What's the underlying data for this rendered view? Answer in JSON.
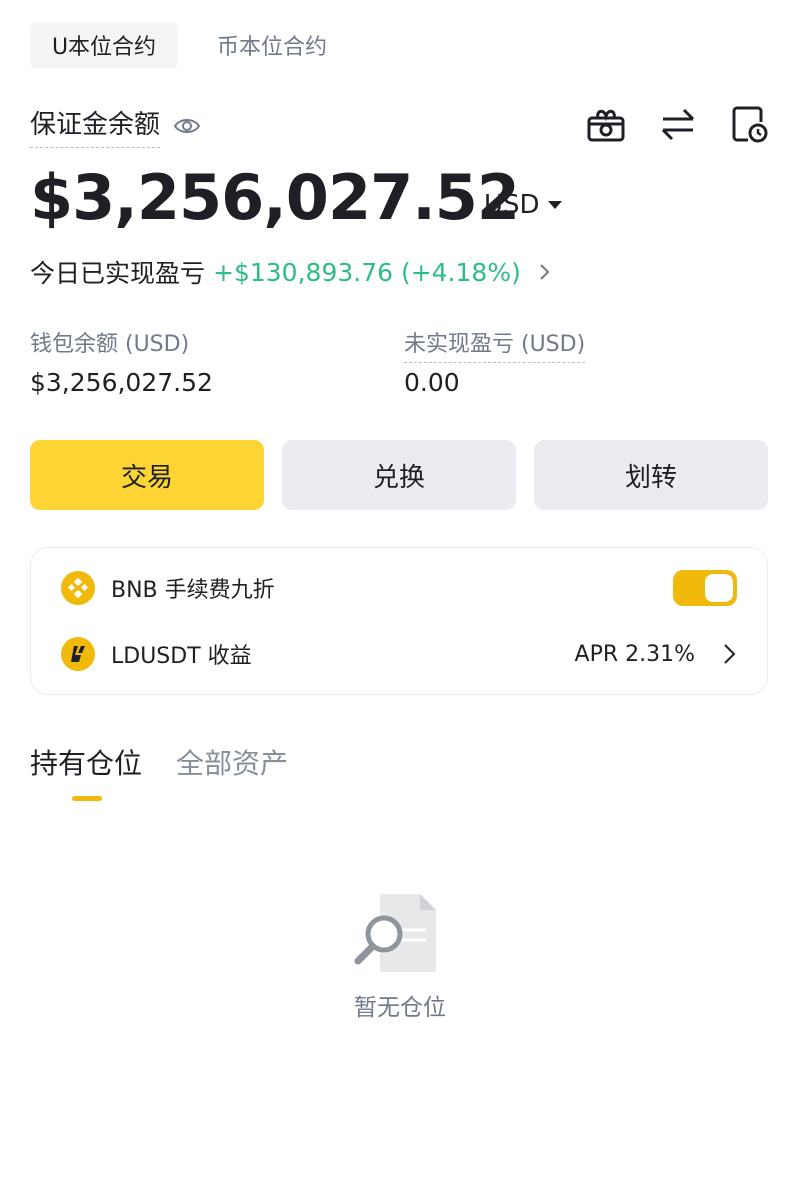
{
  "top_tabs": [
    {
      "label": "U本位合约",
      "active": true
    },
    {
      "label": "币本位合约",
      "active": false
    }
  ],
  "balance": {
    "label": "保证金余额",
    "total": "$3,256,027.52",
    "currency": "USD"
  },
  "header_icons": [
    "gift-box-icon",
    "swap-arrows-icon",
    "history-clock-icon"
  ],
  "todays_pnl": {
    "label": "今日已实现盈亏",
    "value": "+$130,893.76 (+4.18%)",
    "color": "#2ebd85"
  },
  "stats": [
    {
      "label": "钱包余额 (USD)",
      "value": "$3,256,027.52"
    },
    {
      "label": "未实现盈亏 (USD)",
      "value": "0.00"
    }
  ],
  "actions": [
    {
      "label": "交易",
      "style": "primary"
    },
    {
      "label": "兑换",
      "style": "secondary"
    },
    {
      "label": "划转",
      "style": "secondary"
    }
  ],
  "features": [
    {
      "label": "BNB 手续费九折",
      "icon": "bnb-icon",
      "toggle_on": true
    },
    {
      "label": "LDUSDT 收益",
      "icon": "ldusdt-icon",
      "value": "APR 2.31%"
    }
  ],
  "bottom_tabs": [
    {
      "label": "持有仓位",
      "active": true
    },
    {
      "label": "全部资产",
      "active": false
    }
  ],
  "empty_state": {
    "text": "暂无仓位",
    "icon": "document-search-icon"
  },
  "colors": {
    "accent": "#fcd535",
    "positive": "#2ebd85",
    "text_primary": "#1e2026",
    "text_secondary": "#707a8a"
  }
}
